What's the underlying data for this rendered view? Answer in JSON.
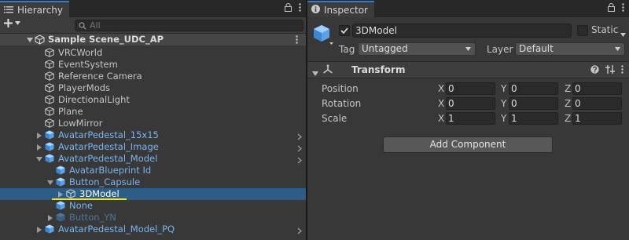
{
  "hierarchy": {
    "tab_title": "Hierarchy",
    "search_placeholder": "All",
    "scene": "Sample Scene_UDC_AP",
    "items": [
      {
        "label": "VRCWorld"
      },
      {
        "label": "EventSystem"
      },
      {
        "label": "Reference Camera"
      },
      {
        "label": "PlayerMods"
      },
      {
        "label": "DirectionalLight"
      },
      {
        "label": "Plane"
      },
      {
        "label": "LowMirror"
      },
      {
        "label": "AvatarPedestal_15x15"
      },
      {
        "label": "AvatarPedestal_Image"
      },
      {
        "label": "AvatarPedestal_Model"
      },
      {
        "label": "AvatarBlueprint Id"
      },
      {
        "label": "Button_Capsule"
      },
      {
        "label": "3DModel"
      },
      {
        "label": "None"
      },
      {
        "label": "Button_YN"
      },
      {
        "label": "AvatarPedestal_Model_PQ"
      }
    ]
  },
  "inspector": {
    "tab_title": "Inspector",
    "object_name": "3DModel",
    "static_label": "Static",
    "tag_label": "Tag",
    "tag_value": "Untagged",
    "layer_label": "Layer",
    "layer_value": "Default",
    "transform": {
      "title": "Transform",
      "rows": [
        {
          "label": "Position",
          "x": "0",
          "y": "0",
          "z": "0"
        },
        {
          "label": "Rotation",
          "x": "0",
          "y": "0",
          "z": "0"
        },
        {
          "label": "Scale",
          "x": "1",
          "y": "1",
          "z": "1"
        }
      ],
      "axis_labels": {
        "x": "X",
        "y": "Y",
        "z": "Z"
      }
    },
    "add_component_label": "Add Component"
  },
  "colors": {
    "selection": "#2c5d87",
    "prefab_blue": "#7ab4ef",
    "highlight_underline": "#f5e51b"
  }
}
